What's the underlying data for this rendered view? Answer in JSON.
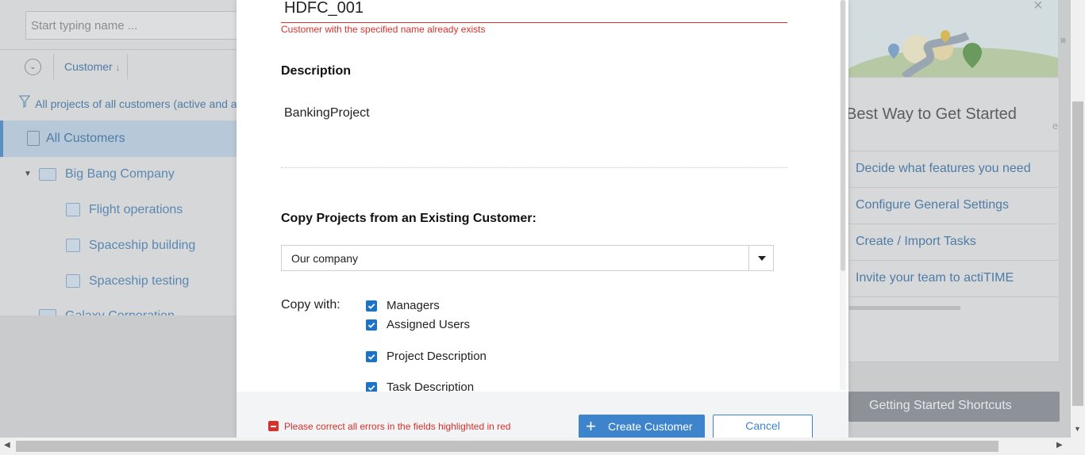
{
  "background": {
    "search_placeholder": "Start typing name ...",
    "column_header": "Customer",
    "filter_text": "All projects of all customers (active and arc",
    "tree": {
      "all_customers": "All Customers",
      "customers": [
        {
          "name": "Big Bang Company",
          "projects": [
            "Flight operations",
            "Spaceship building",
            "Spaceship testing"
          ]
        },
        {
          "name": "Galaxy Corporation"
        }
      ]
    },
    "getting_started": {
      "title": "Best Way to Get Started",
      "links": [
        "Decide what features you need",
        "Configure General Settings",
        "Create / Import Tasks",
        "Invite your team to actiTIME"
      ],
      "shortcuts_button": "Getting Started Shortcuts"
    }
  },
  "modal": {
    "customer_name_value": "HDFC_001",
    "customer_name_error": "Customer with the specified name already exists",
    "description_label": "Description",
    "description_value": "BankingProject",
    "copy_projects_label": "Copy Projects from an Existing Customer:",
    "copy_from_selected": "Our company",
    "copy_with_label": "Copy with:",
    "copy_with_options": [
      {
        "label": "Managers",
        "checked": true
      },
      {
        "label": "Assigned Users",
        "checked": true
      },
      {
        "label": "Project Description",
        "checked": true
      },
      {
        "label": "Task Description",
        "checked": true
      }
    ],
    "footer": {
      "error_message": "Please correct all errors in the fields highlighted in red",
      "create_button": "Create Customer",
      "create_icon": "plus-icon",
      "cancel_button": "Cancel"
    }
  },
  "colors": {
    "accent": "#3d84cc",
    "error": "#d8302a",
    "checkbox": "#1a73c8"
  }
}
